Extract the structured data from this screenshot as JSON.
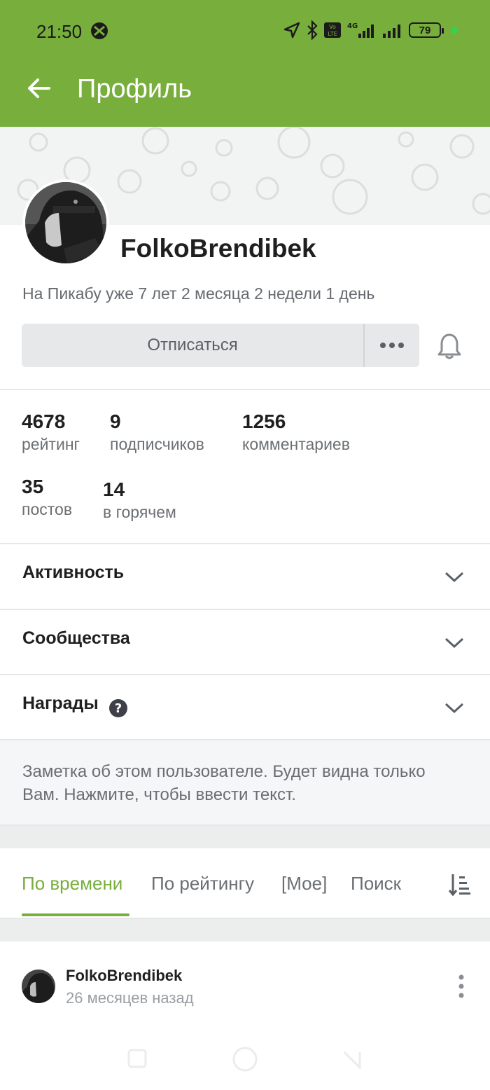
{
  "colors": {
    "accent": "#78ae3c"
  },
  "status_bar": {
    "time": "21:50",
    "battery": "79",
    "icons": [
      "xbox-icon",
      "location-icon",
      "bluetooth-icon",
      "volte-icon",
      "4g-signal-icon",
      "signal-icon",
      "battery-icon"
    ]
  },
  "app_bar": {
    "title": "Профиль",
    "back_icon": "arrow-left-icon"
  },
  "profile": {
    "username": "FolkoBrendibek",
    "since": "На Пикабу уже 7 лет 2 месяца 2 недели 1 день",
    "unsubscribe_label": "Отписаться",
    "more_icon": "more-horizontal-icon",
    "bell_icon": "bell-icon"
  },
  "stats": [
    {
      "value": "4678",
      "label": "рейтинг"
    },
    {
      "value": "9",
      "label": "подписчиков"
    },
    {
      "value": "1256",
      "label": "комментариев"
    },
    {
      "value": "35",
      "label": "постов"
    },
    {
      "value": "14",
      "label": "в горячем"
    }
  ],
  "sections": [
    {
      "label": "Активность"
    },
    {
      "label": "Сообщества"
    },
    {
      "label": "Награды"
    }
  ],
  "note": {
    "text": "Заметка об этом пользователе. Будет видна только Вам. Нажмите, чтобы ввести текст."
  },
  "tabs": [
    {
      "label": "По времени",
      "active": true
    },
    {
      "label": "По рейтингу"
    },
    {
      "label": "[Мое]"
    },
    {
      "label": "Поиск"
    }
  ],
  "post": {
    "author": "FolkoBrendibek",
    "time": "26 месяцев назад"
  }
}
